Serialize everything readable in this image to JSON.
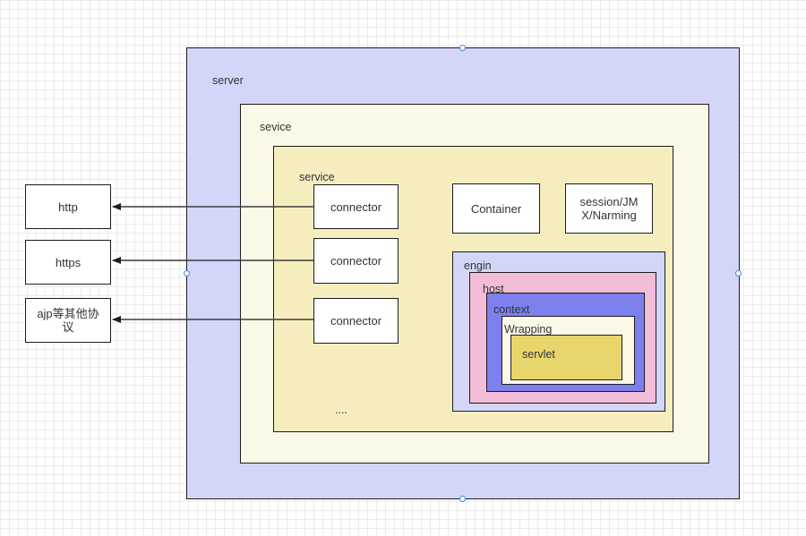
{
  "colors": {
    "server_fill": "#d4d6f9",
    "sevice_fill": "#fcf8e8",
    "service_fill": "#f6edbf",
    "engin_fill": "#d4d6f9",
    "host_fill": "#f3bcd9",
    "context_fill": "#7d80ec",
    "wrapping_fill": "#fcf8e8",
    "servlet_fill": "#e8d66c",
    "handle_stroke": "#3a8ee6",
    "line": "#1c1c1c"
  },
  "containers": {
    "server": "server",
    "sevice": "sevice",
    "service": "service",
    "engin": "engin",
    "host": "host",
    "context": "context",
    "wrapping": "Wrapping",
    "servlet": "servlet"
  },
  "nodes": {
    "container": "Container",
    "session": "session/JMX/Narming",
    "ellipsis": "...."
  },
  "connectors": [
    "connector",
    "connector",
    "connector"
  ],
  "protocols": [
    "http",
    "https",
    "ajp等其他协议"
  ]
}
